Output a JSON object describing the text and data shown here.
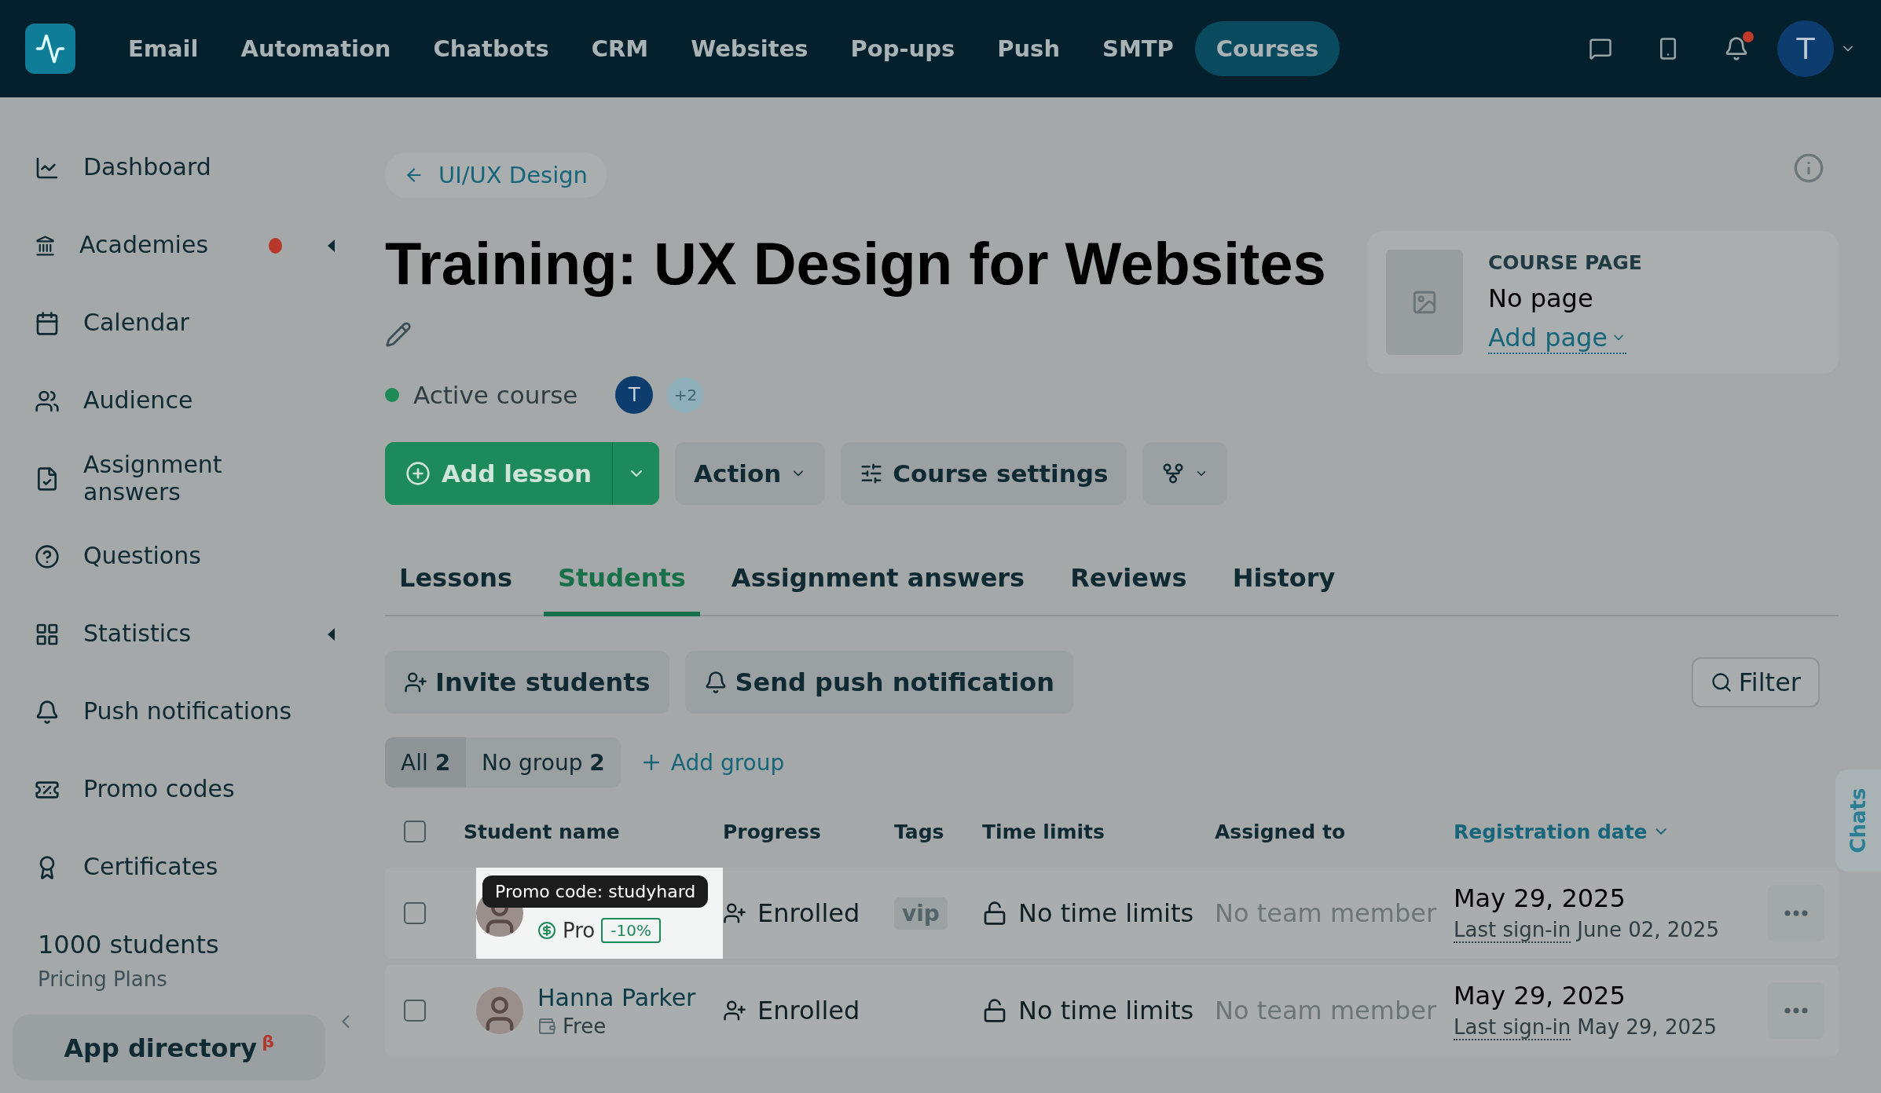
{
  "top_nav": {
    "items": [
      {
        "label": "Email",
        "selected": false
      },
      {
        "label": "Automation",
        "selected": false
      },
      {
        "label": "Chatbots",
        "selected": false
      },
      {
        "label": "CRM",
        "selected": false
      },
      {
        "label": "Websites",
        "selected": false
      },
      {
        "label": "Pop-ups",
        "selected": false
      },
      {
        "label": "Push",
        "selected": false
      },
      {
        "label": "SMTP",
        "selected": false
      },
      {
        "label": "Courses",
        "selected": true
      }
    ],
    "has_unread": true,
    "user_initial": "T"
  },
  "sidebar": {
    "items": [
      {
        "label": "Dashboard",
        "dot": false,
        "submenu": false
      },
      {
        "label": "Academies",
        "dot": true,
        "submenu": true
      },
      {
        "label": "Calendar",
        "dot": false,
        "submenu": false
      },
      {
        "label": "Audience",
        "dot": false,
        "submenu": false
      },
      {
        "label": "Assignment answers",
        "dot": false,
        "submenu": false
      },
      {
        "label": "Questions",
        "dot": false,
        "submenu": false
      },
      {
        "label": "Statistics",
        "dot": false,
        "submenu": true
      },
      {
        "label": "Push notifications",
        "dot": false,
        "submenu": false
      },
      {
        "label": "Promo codes",
        "dot": false,
        "submenu": false
      },
      {
        "label": "Certificates",
        "dot": false,
        "submenu": false
      }
    ],
    "plan": {
      "students": "1000 students",
      "link": "Pricing Plans"
    },
    "app_directory": {
      "label": "App directory",
      "mark": "β"
    }
  },
  "breadcrumb": "UI/UX Design",
  "title": "Training: UX Design for Websites",
  "status": {
    "label": "Active course",
    "active": true
  },
  "members": {
    "initial": "T",
    "more": "+2"
  },
  "actions": {
    "add_lesson": "Add lesson",
    "action": "Action",
    "settings": "Course settings"
  },
  "course_page": {
    "heading": "COURSE PAGE",
    "value": "No page",
    "link": "Add page"
  },
  "tabs": [
    {
      "label": "Lessons",
      "selected": false
    },
    {
      "label": "Students",
      "selected": true
    },
    {
      "label": "Assignment answers",
      "selected": false
    },
    {
      "label": "Reviews",
      "selected": false
    },
    {
      "label": "History",
      "selected": false
    }
  ],
  "toolbar": {
    "invite": "Invite students",
    "push": "Send push notification",
    "filter": "Filter"
  },
  "groups": [
    {
      "label": "All",
      "count": "2",
      "selected": true
    },
    {
      "label": "No group",
      "count": "2",
      "selected": false
    }
  ],
  "add_group": "Add group",
  "table": {
    "select_all": {
      "checked": false
    },
    "columns": [
      {
        "label": "Student name",
        "sorted": false
      },
      {
        "label": "Progress",
        "sorted": false
      },
      {
        "label": "Tags",
        "sorted": false
      },
      {
        "label": "Time limits",
        "sorted": false
      },
      {
        "label": "Assigned to",
        "sorted": false
      },
      {
        "label": "Registration date",
        "sorted": true
      }
    ],
    "rows": [
      {
        "checked": false,
        "highlighted": true,
        "plan": "Pro",
        "kind": "paid",
        "promo": "-10%",
        "progress": "Enrolled",
        "tag": "vip",
        "time_limit": "No time limits",
        "assigned": "No team member",
        "reg_date": "May 29, 2025",
        "signin_label": "Last sign-in",
        "signin_date": "June 02, 2025"
      },
      {
        "checked": false,
        "highlighted": false,
        "name": "Hanna Parker",
        "plan": "Free",
        "kind": "free",
        "progress": "Enrolled",
        "time_limit": "No time limits",
        "assigned": "No team member",
        "reg_date": "May 29, 2025",
        "signin_label": "Last sign-in",
        "signin_date": "May 29, 2025"
      }
    ]
  },
  "tooltip": "Promo code: studyhard",
  "chats": "Chats"
}
